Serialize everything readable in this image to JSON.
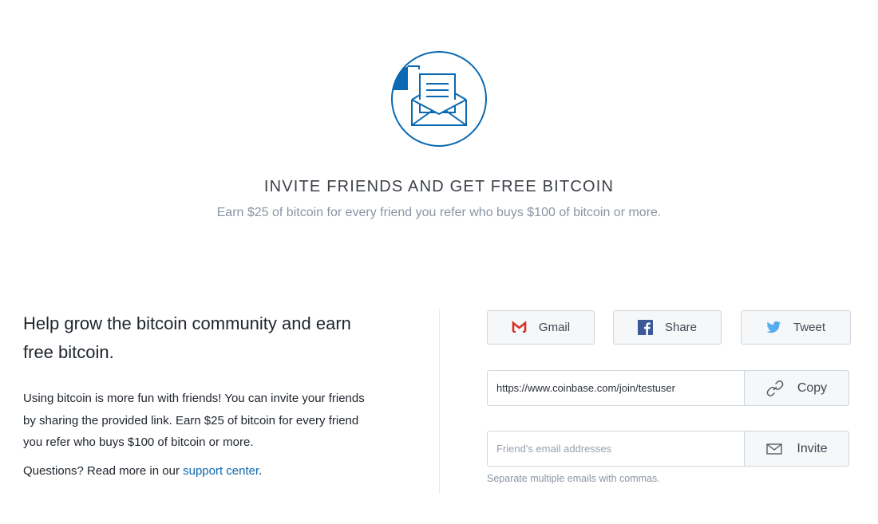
{
  "hero": {
    "icon": "envelope-letter-icon",
    "title": "INVITE FRIENDS AND GET FREE BITCOIN",
    "subtitle": "Earn $25 of bitcoin for every friend you refer who buys $100 of bitcoin or more."
  },
  "info": {
    "heading": "Help grow the bitcoin community and earn free bitcoin.",
    "body": "Using bitcoin is more fun with friends! You can invite your friends by sharing the provided link. Earn $25 of bitcoin for every friend you refer who buys $100 of bitcoin or more.",
    "questions_prefix": "Questions? Read more in our ",
    "support_link": "support center",
    "questions_suffix": "."
  },
  "share": {
    "gmail": {
      "label": "Gmail",
      "icon": "gmail-icon"
    },
    "facebook": {
      "label": "Share",
      "icon": "facebook-icon"
    },
    "twitter": {
      "label": "Tweet",
      "icon": "twitter-icon"
    }
  },
  "referral": {
    "link_value": "https://www.coinbase.com/join/testuser",
    "copy_label": "Copy",
    "copy_icon": "link-icon"
  },
  "invite": {
    "placeholder": "Friend's email addresses",
    "button_label": "Invite",
    "button_icon": "mail-icon",
    "hint": "Separate multiple emails with commas."
  },
  "colors": {
    "brand_blue": "#0b69b1",
    "gmail_red": "#d93025",
    "facebook_blue": "#3b5998",
    "twitter_blue": "#55acee"
  }
}
